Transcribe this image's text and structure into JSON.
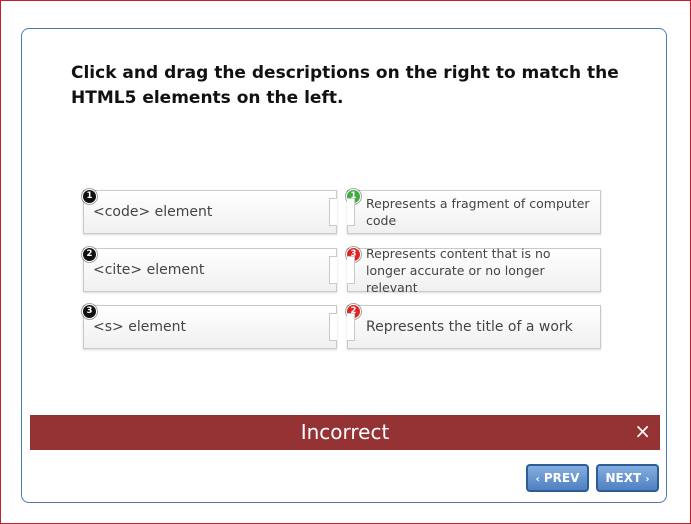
{
  "question": "Click and drag the descriptions on the right to match the HTML5 elements on the left.",
  "elements": [
    {
      "badge": "1",
      "label": "<code> element"
    },
    {
      "badge": "2",
      "label": "<cite> element"
    },
    {
      "badge": "3",
      "label": "<s> element"
    }
  ],
  "descriptions": [
    {
      "badge": "1",
      "label": "Represents a fragment of computer code",
      "status_color": "#3fae3f"
    },
    {
      "badge": "3",
      "label": "Represents content that is no longer accurate or no longer relevant",
      "status_color": "#e02424"
    },
    {
      "badge": "2",
      "label": "Represents the title of a work",
      "status_color": "#e02424"
    }
  ],
  "feedback": {
    "text": "Incorrect",
    "close_glyph": "×",
    "color": "#943234"
  },
  "nav": {
    "prev_label": "PREV",
    "next_label": "NEXT",
    "prev_glyph": "‹",
    "next_glyph": "›"
  }
}
